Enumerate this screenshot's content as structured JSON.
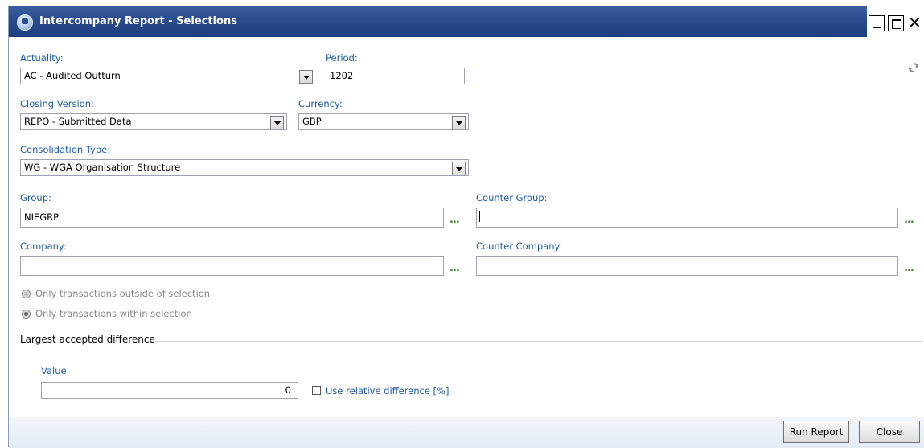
{
  "window": {
    "title": "Intercompany Report - Selections"
  },
  "icons": {
    "app": "app-icon",
    "refresh": "refresh-icon",
    "minimize": "minimize-icon",
    "maximize": "maximize-icon",
    "close": "close-icon"
  },
  "form": {
    "actuality": {
      "label": "Actuality:",
      "value": "AC - Audited Outturn"
    },
    "period": {
      "label": "Period:",
      "value": "1202"
    },
    "closing_version": {
      "label": "Closing Version:",
      "value": "REPO - Submitted Data"
    },
    "currency": {
      "label": "Currency:",
      "value": "GBP"
    },
    "consolidation_type": {
      "label": "Consolidation Type:",
      "value": "WG - WGA Organisation Structure"
    },
    "group": {
      "label": "Group:",
      "value": "NIEGRP",
      "browse": "..."
    },
    "counter_group": {
      "label": "Counter Group:",
      "value": "",
      "browse": "..."
    },
    "company": {
      "label": "Company:",
      "value": "",
      "browse": "..."
    },
    "counter_company": {
      "label": "Counter Company:",
      "value": "",
      "browse": "..."
    },
    "radio_outside": {
      "label": "Only transactions outside of selection",
      "checked": false
    },
    "radio_within": {
      "label": "Only transactions within selection",
      "checked": true
    }
  },
  "difference": {
    "section_title": "Largest accepted difference",
    "value_label": "Value",
    "value": "0",
    "relative_label": "Use relative difference [%]",
    "relative_checked": false
  },
  "footer": {
    "run_label": "Run Report",
    "close_label": "Close"
  },
  "colors": {
    "title_bar": "#2a4d8f",
    "label_blue": "#1c5aa6",
    "footer_bg": "#e3ebf5"
  }
}
